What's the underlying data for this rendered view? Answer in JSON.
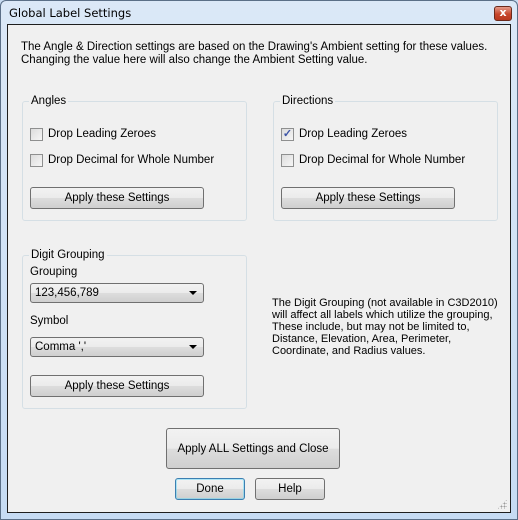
{
  "window": {
    "title": "Global Label Settings",
    "close_icon": "close-icon"
  },
  "intro": {
    "line1": "The Angle & Direction settings are based on the Drawing's Ambient setting for these values.",
    "line2": "Changing the value here will also change the Ambient Setting value."
  },
  "angles": {
    "title": "Angles",
    "drop_leading_zeroes": {
      "label": "Drop Leading Zeroes",
      "checked": false
    },
    "drop_decimal": {
      "label": "Drop Decimal for Whole Number",
      "checked": false
    },
    "apply_label": "Apply these Settings"
  },
  "directions": {
    "title": "Directions",
    "drop_leading_zeroes": {
      "label": "Drop Leading Zeroes",
      "checked": true
    },
    "drop_decimal": {
      "label": "Drop Decimal for Whole Number",
      "checked": false
    },
    "apply_label": "Apply these Settings"
  },
  "digit_grouping": {
    "title": "Digit Grouping",
    "grouping_label": "Grouping",
    "grouping_value": "123,456,789",
    "symbol_label": "Symbol",
    "symbol_value": "Comma ','",
    "apply_label": "Apply these Settings"
  },
  "info": {
    "text": "The Digit Grouping (not available in C3D2010) will affect all labels which utilize the grouping, These include, but may not be limited to, Distance, Elevation, Area, Perimeter, Coordinate, and Radius values."
  },
  "footer": {
    "apply_all_label": "Apply ALL Settings and Close",
    "done_label": "Done",
    "help_label": "Help"
  },
  "check_glyph": "✓",
  "close_glyph": "x"
}
